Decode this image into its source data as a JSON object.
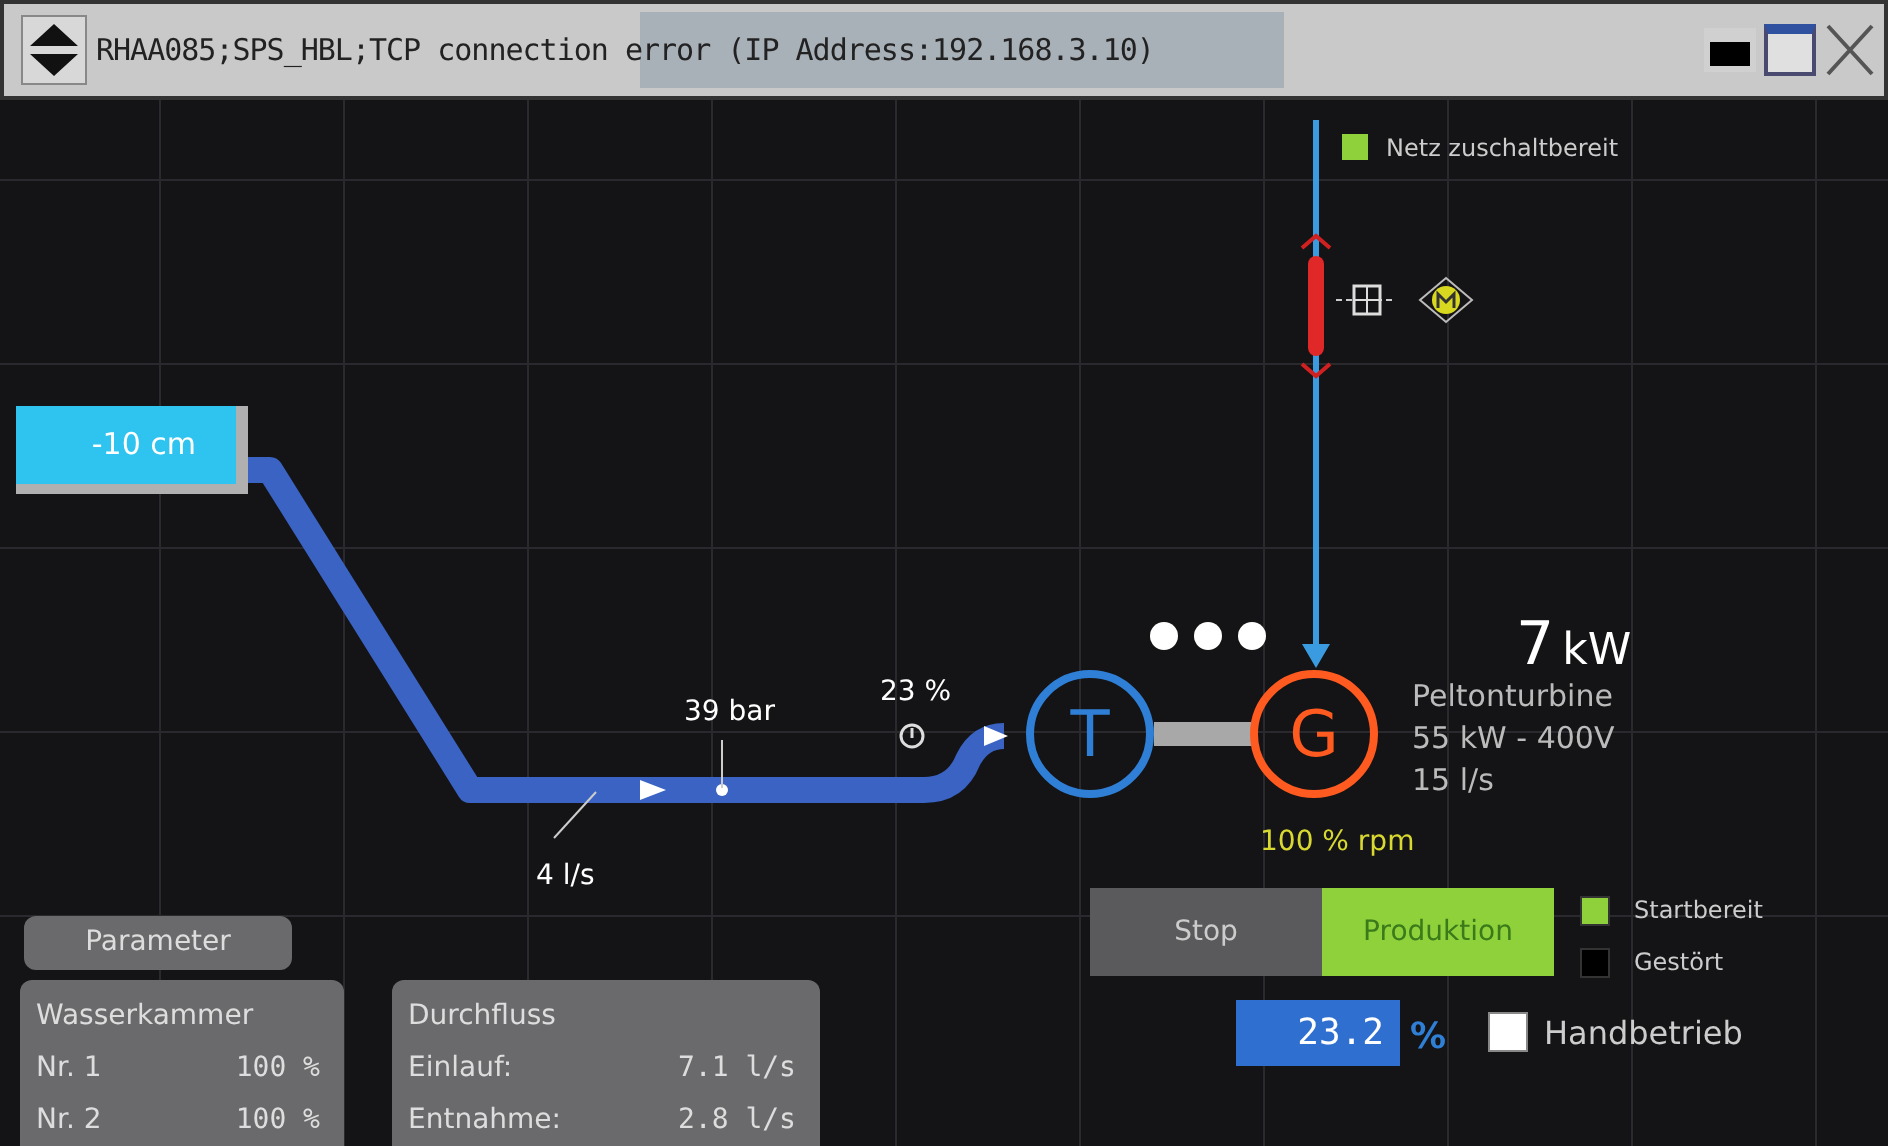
{
  "window": {
    "title": "RHAA085;SPS_HBL;TCP connection error (IP Address:192.168.3.10)"
  },
  "grid_status": {
    "label": "Netz zuschaltbereit",
    "color": "#8fd13a"
  },
  "tank": {
    "level_text": "-10 cm"
  },
  "pipe": {
    "pressure": "39 bar",
    "flow": "4 l/s",
    "valve_opening": "23 %"
  },
  "turbine": {
    "symbol": "T"
  },
  "generator": {
    "symbol": "G",
    "speed": "100 % rpm"
  },
  "power": {
    "value": "7",
    "unit": "kW"
  },
  "specs": [
    "Peltonturbine",
    "55 kW - 400V",
    "15 l/s"
  ],
  "mode_buttons": [
    {
      "label": "Stop",
      "selected": false
    },
    {
      "label": "Produktion",
      "selected": true
    }
  ],
  "indicators": [
    {
      "label": "Startbereit",
      "color": "#8fd13a"
    },
    {
      "label": "Gestört",
      "color": "#000000"
    }
  ],
  "setpoint": {
    "value": "23.2",
    "unit": "%"
  },
  "manual": {
    "label": "Handbetrieb",
    "checked": false
  },
  "parameter_button": "Parameter",
  "panels": [
    {
      "title": "Wasserkammer",
      "rows": [
        {
          "label": "Nr. 1",
          "value": "100 %"
        },
        {
          "label": "Nr. 2",
          "value": "100 %"
        }
      ]
    },
    {
      "title": "Durchfluss",
      "rows": [
        {
          "label": "Einlauf:",
          "value": "7.1 l/s"
        },
        {
          "label": "Entnahme:",
          "value": "2.8 l/s"
        }
      ]
    }
  ]
}
